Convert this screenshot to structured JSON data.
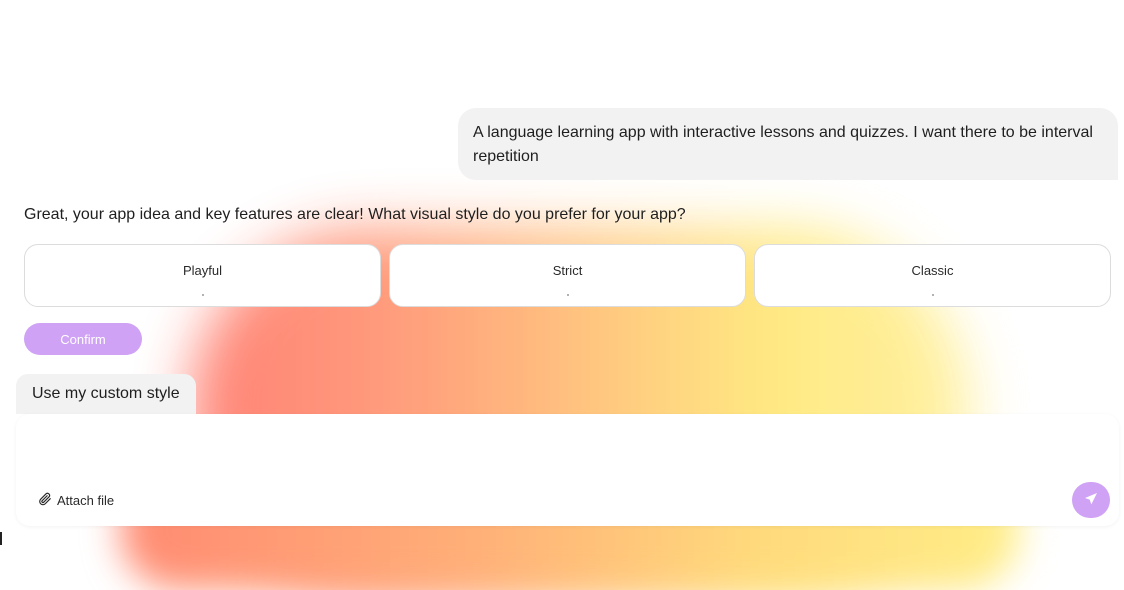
{
  "chat": {
    "user_message": "A language learning app with interactive lessons and quizzes. I want there to be interval repetition",
    "assistant_message": "Great, your app idea and key features are clear! What visual style do you prefer for your app?"
  },
  "style_options": [
    {
      "label": "Playful"
    },
    {
      "label": "Strict"
    },
    {
      "label": "Classic"
    }
  ],
  "actions": {
    "confirm_label": "Confirm",
    "custom_style_label": "Use my custom style"
  },
  "composer": {
    "value": "",
    "attach_label": "Attach file"
  },
  "icons": {
    "attach": "paperclip-icon",
    "send": "send-arrow-icon"
  },
  "colors": {
    "accent": "#cfa2f5",
    "bubble_bg": "#f2f2f2",
    "option_border": "#dcdcdc"
  }
}
